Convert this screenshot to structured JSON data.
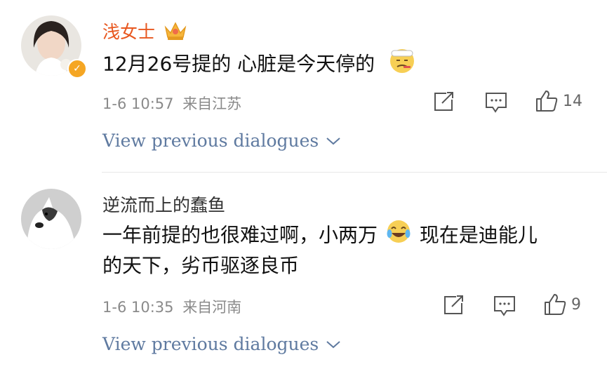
{
  "comments": [
    {
      "username": "浅女士",
      "text_lines": [
        "12月26号提的 心脏是今天停的"
      ],
      "timestamp": "1-6 10:57",
      "location": "来自江苏",
      "like_count": "14",
      "view_previous": "View previous dialogues"
    },
    {
      "username": "逆流而上的蠢鱼",
      "text_lines": [
        "一年前提的也很难过啊，小两万",
        "现在是迪能儿",
        "的天下，劣币驱逐良币"
      ],
      "timestamp": "1-6 10:35",
      "location": "来自河南",
      "like_count": "9",
      "view_previous": "View previous dialogues"
    }
  ],
  "colors": {
    "username_vip": "#e8571f",
    "username_normal": "#333333",
    "meta": "#8a8a8a",
    "link": "#5f7aa0",
    "badge": "#f5a623"
  },
  "icons": [
    "crown-icon",
    "verified-badge-icon",
    "share-icon",
    "comment-icon",
    "like-icon",
    "chevron-down-icon",
    "sick-face-emoji",
    "laugh-tears-emoji"
  ]
}
